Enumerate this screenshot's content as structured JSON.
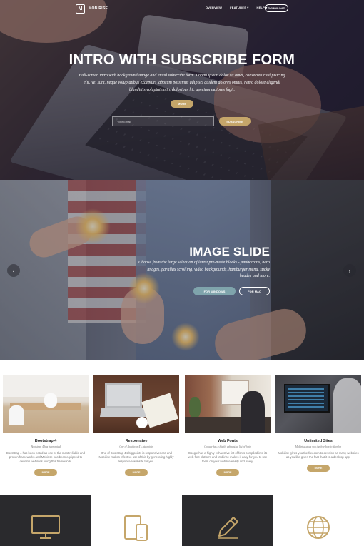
{
  "navbar": {
    "brand": "MOBIRISE",
    "logo_letter": "M",
    "links": [
      "OVERVIEW",
      "FEATURES ▾",
      "HELP ▾"
    ],
    "download_label": "DOWNLOAD"
  },
  "hero": {
    "title": "INTRO WITH SUBSCRIBE FORM",
    "text": "Full-screen intro with background image and email subscribe form. Lorem ipsum dolor sit amet, consectetur adipisicing elit. Vel sunt, neque voluptatibus excepturi laborum possimus adipisci quidem dolores omnis, nemo dolore eligendi blanditiis voluptatem in, doloribus hic aperiam maiores fugit.",
    "more_label": "MORE",
    "email_placeholder": "Your Email",
    "subscribe_label": "SUBSCRIBE"
  },
  "slider": {
    "title": "IMAGE SLIDE",
    "text": "Choose from the large selection of latest pre-made blocks - jumbotrons, hero images, parallax scrolling, video backgrounds, hamburger menu, sticky header and more.",
    "button_windows": "FOR WINDOWS",
    "button_mac": "FOR MAC",
    "prev_icon": "‹",
    "next_icon": "›"
  },
  "features": [
    {
      "title": "Bootstrap 4",
      "subtitle": "Bootstrap 4 has been noted",
      "text": "Bootstrap 4 has been noted as one of the most reliable and proven frameworks and Mobirise has been equipped to develop websites using this framework.",
      "more": "MORE"
    },
    {
      "title": "Responsive",
      "subtitle": "One of Bootstrap 4's big points",
      "text": "One of Bootstrap 4's big points is responsiveness and Mobirise makes effective use of this by generating highly responsive website for you.",
      "more": "MORE"
    },
    {
      "title": "Web Fonts",
      "subtitle": "Google has a highly exhaustive list of fonts",
      "text": "Google has a highly exhaustive list of fonts compiled into its web font platform and Mobirise makes it easy for you to use them on your website easily and freely.",
      "more": "MORE"
    },
    {
      "title": "Unlimited Sites",
      "subtitle": "Mobirise gives you the freedom to develop",
      "text": "Mobirise gives you the freedom to develop as many websites as you like given the fact that it is a desktop app.",
      "more": "MORE"
    }
  ],
  "icon_features": [
    {
      "icon": "desktop-monitor-icon",
      "tone": "dark"
    },
    {
      "icon": "mobile-devices-icon",
      "tone": "light"
    },
    {
      "icon": "pencil-icon",
      "tone": "dark"
    },
    {
      "icon": "globe-icon",
      "tone": "light"
    }
  ],
  "colors": {
    "accent": "#c5a66a",
    "teal_button": "#7fa4ac",
    "dark_tile": "#2a2a2d",
    "icon_gold": "#c5a66a"
  }
}
